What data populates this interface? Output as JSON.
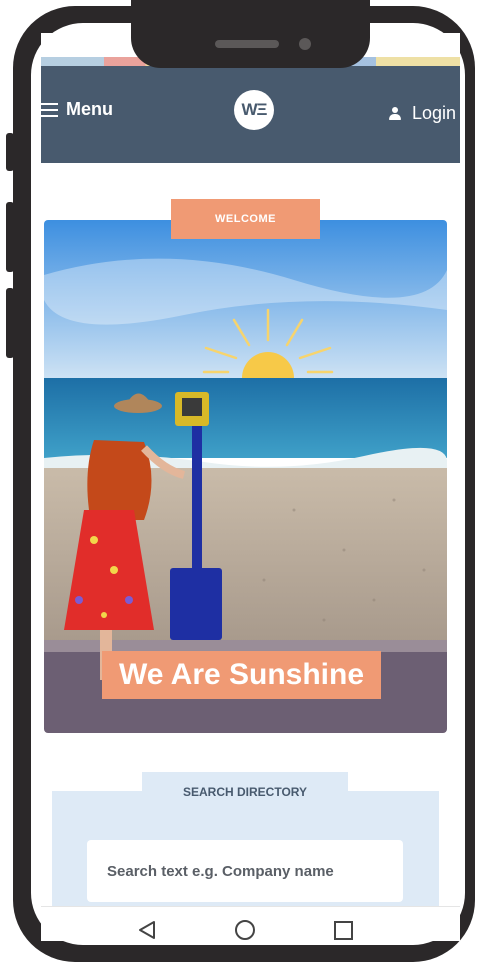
{
  "navbar": {
    "menu_label": "Menu",
    "logo_text": "WΞ",
    "login_label": "Login",
    "bg_color": "#485a6e"
  },
  "hero": {
    "welcome_label": "WELCOME",
    "title": "We Are Sunshine",
    "accent_color": "#f09a74"
  },
  "search": {
    "tab_label": "SEARCH DIRECTORY",
    "placeholder": "Search text e.g. Company name",
    "panel_color": "#deeaf6"
  },
  "icons": {
    "menu": "hamburger-icon",
    "login": "user-icon",
    "back": "back-triangle-icon",
    "home": "home-circle-icon",
    "recent": "recent-square-icon"
  }
}
